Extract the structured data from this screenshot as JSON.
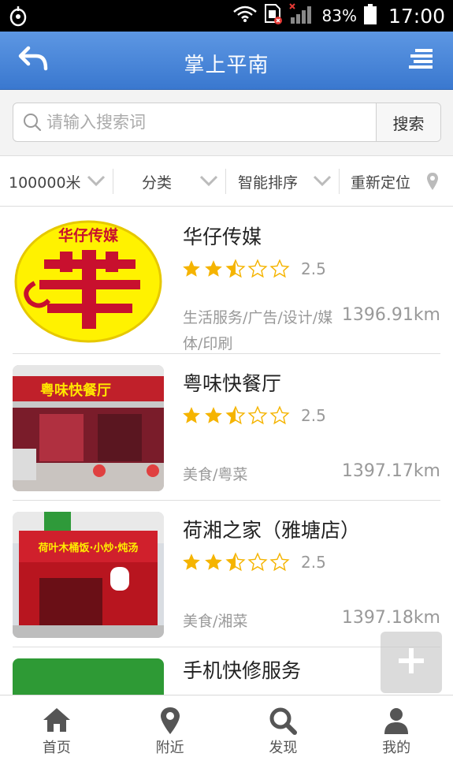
{
  "status": {
    "battery": "83%",
    "time": "17:00"
  },
  "header": {
    "title": "掌上平南"
  },
  "search": {
    "placeholder": "请输入搜索词",
    "value": "",
    "button": "搜索"
  },
  "filters": {
    "distance": "100000米",
    "category": "分类",
    "sort": "智能排序",
    "relocate": "重新定位"
  },
  "listings": [
    {
      "name": "华仔传媒",
      "rating": 2.5,
      "score": "2.5",
      "category": "生活服务/广告/设计/媒体/印刷",
      "distance": "1396.91km",
      "logo_top": "华仔传媒"
    },
    {
      "name": "粤味快餐厅",
      "rating": 2.5,
      "score": "2.5",
      "category": "美食/粤菜",
      "distance": "1397.17km",
      "sign": "粤味快餐厅"
    },
    {
      "name": "荷湘之家（雅塘店）",
      "rating": 2.5,
      "score": "2.5",
      "category": "美食/湘菜",
      "distance": "1397.18km",
      "sign": "荷叶木桶饭·小炒·炖汤"
    },
    {
      "name": "手机快修服务"
    }
  ],
  "tabs": [
    {
      "label": "首页",
      "icon": "home-icon"
    },
    {
      "label": "附近",
      "icon": "location-pin-icon"
    },
    {
      "label": "发现",
      "icon": "search-icon"
    },
    {
      "label": "我的",
      "icon": "user-icon"
    }
  ],
  "colors": {
    "header_top": "#5d97e3",
    "header_bottom": "#3a78cf",
    "star": "#f5b400",
    "star_empty": "#f5b400"
  }
}
